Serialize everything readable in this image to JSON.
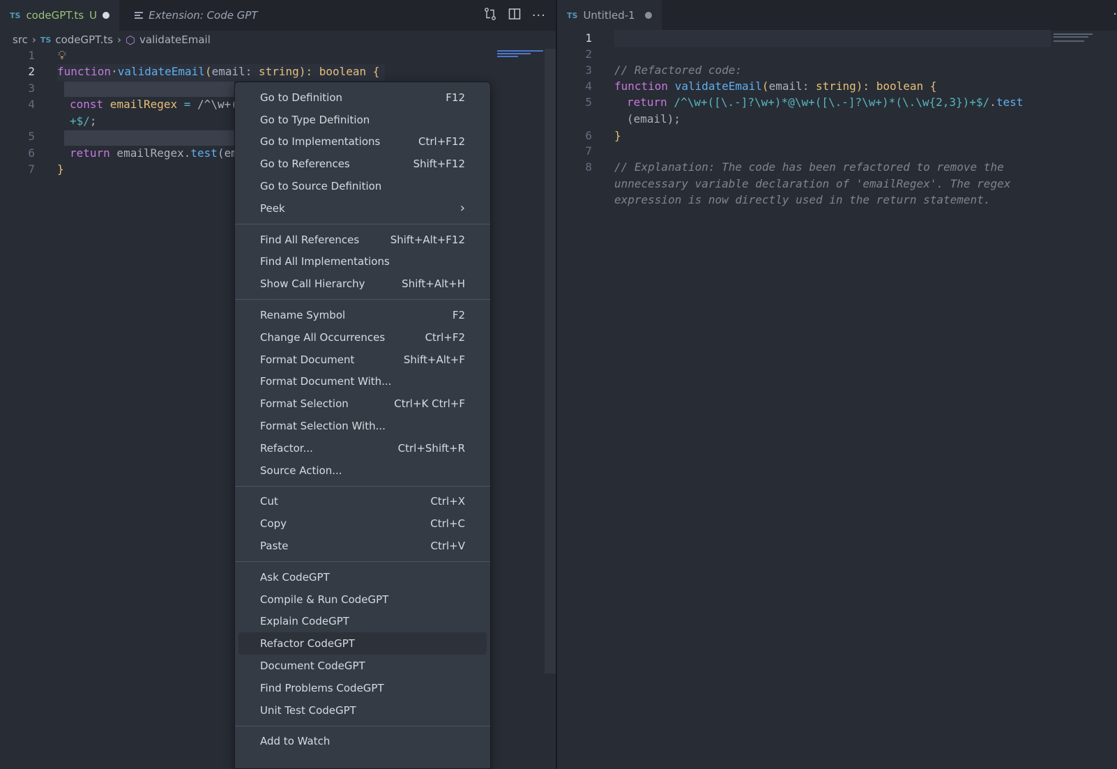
{
  "left_editor": {
    "tabs": [
      {
        "lang": "TS",
        "title": "codeGPT.ts",
        "status": "U"
      },
      {
        "title": "Extension: Code GPT"
      }
    ],
    "breadcrumb": {
      "folder": "src",
      "lang": "TS",
      "file": "codeGPT.ts",
      "symbol": "validateEmail"
    },
    "line_numbers": [
      "1",
      "2",
      "3",
      "4",
      "5",
      "6",
      "7"
    ],
    "code": {
      "l2_kw": "function",
      "l2_fn": "validateEmail",
      "l2_p1": "(",
      "l2_param": "email",
      "l2_colon": ": ",
      "l2_type": "string",
      "l2_p2": "): ",
      "l2_ret": "boolean",
      "l2_brace": " {",
      "l4_kw": "const",
      "l4_var": " emailRegex",
      "l4_eq": " = ",
      "l4_rx": "/^\\w+(",
      "l4b_rx": "+$/",
      "l4b_semi": ";",
      "l6_kw": "return",
      "l6_var": " emailRegex",
      "l6_dot": ".",
      "l6_fn": "test",
      "l6_rest": "(em",
      "l7_brace": "}"
    }
  },
  "right_editor": {
    "tab": {
      "lang": "TS",
      "title": "Untitled-1"
    },
    "line_numbers": [
      "1",
      "2",
      "3",
      "4",
      "5",
      "",
      "6",
      "7",
      "8",
      "",
      ""
    ],
    "code": {
      "l3_comment": "// Refactored code:",
      "l4_kw": "function",
      "l4_fn": " validateEmail",
      "l4_p1": "(",
      "l4_param": "email",
      "l4_colon": ": ",
      "l4_type": "string",
      "l4_p2": "): ",
      "l4_ret": "boolean",
      "l4_brace": " {",
      "l5_kw": "return",
      "l5_rx": " /^\\w+([\\.-]?\\w+)*@\\w+([\\.-]?\\w+)*(\\.\\w{2,3})+$/",
      "l5_dot": ".",
      "l5_fn": "test",
      "l5b": "(email);",
      "l6_brace": "}",
      "l8_comment_1": "// Explanation: The code has been refactored to remove the",
      "l8_comment_2": "unnecessary variable declaration of 'emailRegex'. The regex",
      "l8_comment_3": "expression is now directly used in the return statement."
    }
  },
  "context_menu": {
    "groups": [
      [
        {
          "label": "Go to Definition",
          "kb": "F12"
        },
        {
          "label": "Go to Type Definition",
          "kb": ""
        },
        {
          "label": "Go to Implementations",
          "kb": "Ctrl+F12"
        },
        {
          "label": "Go to References",
          "kb": "Shift+F12"
        },
        {
          "label": "Go to Source Definition",
          "kb": ""
        },
        {
          "label": "Peek",
          "kb": ""
        }
      ],
      [
        {
          "label": "Find All References",
          "kb": "Shift+Alt+F12"
        },
        {
          "label": "Find All Implementations",
          "kb": ""
        },
        {
          "label": "Show Call Hierarchy",
          "kb": "Shift+Alt+H"
        }
      ],
      [
        {
          "label": "Rename Symbol",
          "kb": "F2"
        },
        {
          "label": "Change All Occurrences",
          "kb": "Ctrl+F2"
        },
        {
          "label": "Format Document",
          "kb": "Shift+Alt+F"
        },
        {
          "label": "Format Document With...",
          "kb": ""
        },
        {
          "label": "Format Selection",
          "kb": "Ctrl+K Ctrl+F"
        },
        {
          "label": "Format Selection With...",
          "kb": ""
        },
        {
          "label": "Refactor...",
          "kb": "Ctrl+Shift+R"
        },
        {
          "label": "Source Action...",
          "kb": ""
        }
      ],
      [
        {
          "label": "Cut",
          "kb": "Ctrl+X"
        },
        {
          "label": "Copy",
          "kb": "Ctrl+C"
        },
        {
          "label": "Paste",
          "kb": "Ctrl+V"
        }
      ],
      [
        {
          "label": "Ask CodeGPT",
          "kb": ""
        },
        {
          "label": "Compile & Run CodeGPT",
          "kb": ""
        },
        {
          "label": "Explain CodeGPT",
          "kb": ""
        },
        {
          "label": "Refactor CodeGPT",
          "kb": ""
        },
        {
          "label": "Document CodeGPT",
          "kb": ""
        },
        {
          "label": "Find Problems CodeGPT",
          "kb": ""
        },
        {
          "label": "Unit Test CodeGPT",
          "kb": ""
        }
      ],
      [
        {
          "label": "Add to Watch",
          "kb": ""
        }
      ]
    ]
  },
  "icons": {
    "tab_actions": [
      "open-changes-icon",
      "split-editor-icon",
      "more-actions-icon"
    ],
    "breadcrumb_symbol": "cube-icon",
    "lightbulb": "lightbulb-icon",
    "submenu": "chevron-right-icon"
  },
  "colors": {
    "editor_bg": "#282c34",
    "tabbar_bg": "#21252b",
    "menu_bg": "#353b45",
    "keyword": "#c678dd",
    "function": "#61afef",
    "type": "#e5c07b",
    "variable": "#e06c75",
    "regex": "#56b6c2",
    "comment": "#7f848e"
  }
}
